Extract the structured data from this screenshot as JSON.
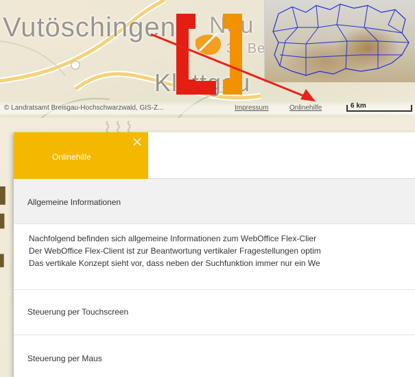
{
  "map": {
    "places": {
      "vutoeschingen": "Vutöschingen",
      "neu": "Neu",
      "klettgau": "Klettgau",
      "road_number": "34 Ber"
    },
    "footer": {
      "copyright": "© Landratsamt Breisgau-Hochschwarzwald, GIS-Z...",
      "impressum": "Impressum",
      "onlinehilfe": "Onlinehilfe",
      "scale": "6 km"
    },
    "arrow_color": "#e8221a",
    "logo_colors": {
      "red": "#e31f13",
      "orange": "#f39200"
    },
    "overview_border_color": "#1f2fd6"
  },
  "panel": {
    "tab_label": "Onlinehilfe",
    "tab_color": "#f5b800",
    "close_icon": "close-icon",
    "sections": {
      "general": "Allgemeine Informationen",
      "touch": "Steuerung per Touchscreen",
      "mouse": "Steuerung per Maus"
    },
    "general_text": [
      "Nachfolgend befinden sich allgemeine Informationen zum WebOffice Flex-Clier",
      "Der WebOffice Flex-Client ist zur Beantwortung vertikaler Fragestellungen optim",
      "Das vertikale Konzept sieht vor, dass neben der Suchfunktion immer nur ein We"
    ]
  }
}
